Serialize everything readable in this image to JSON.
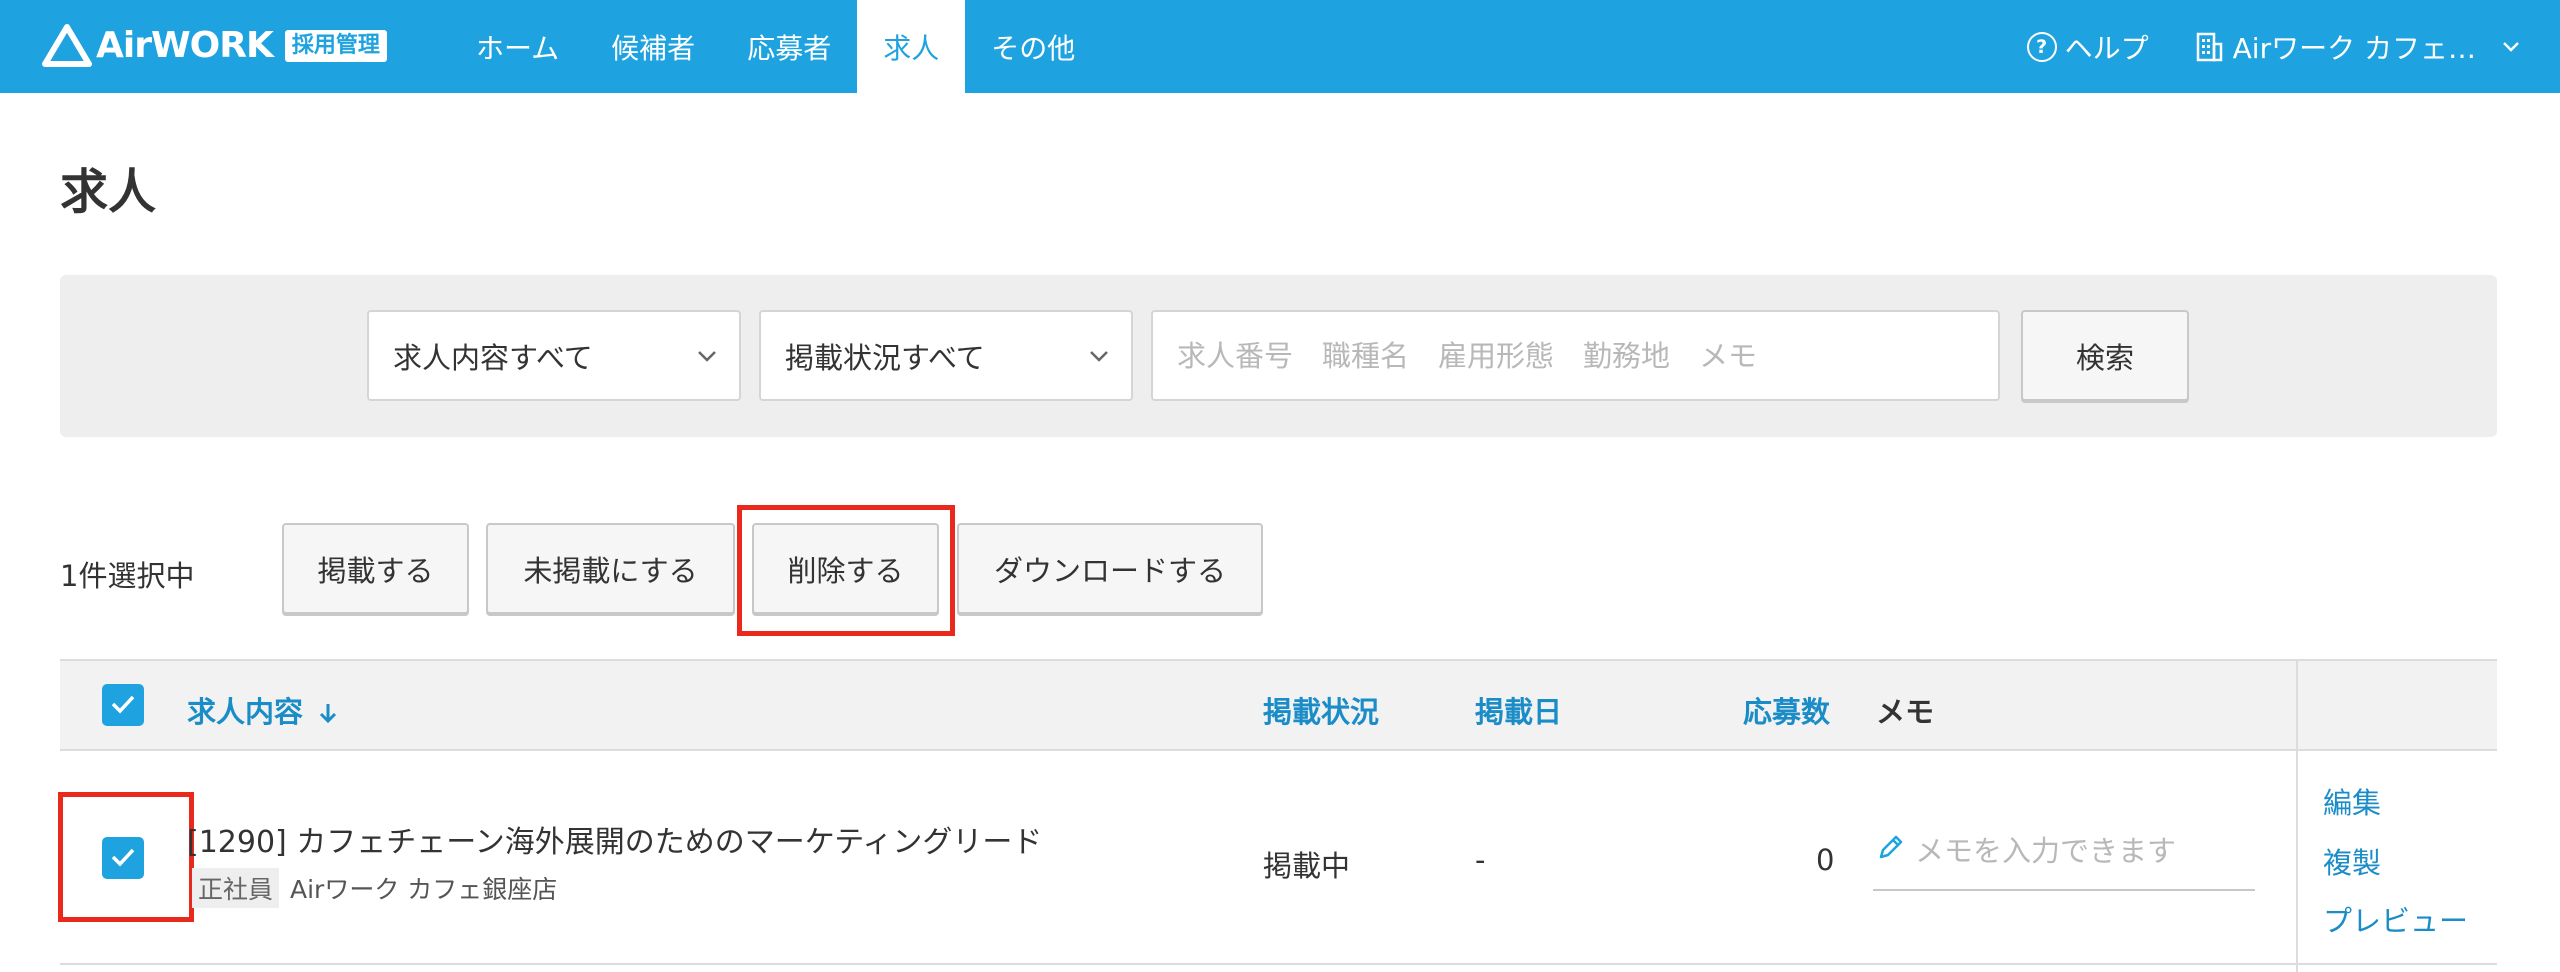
{
  "header": {
    "logo_text": "AirWORK",
    "logo_badge": "採用管理",
    "nav": [
      "ホーム",
      "候補者",
      "応募者",
      "求人",
      "その他"
    ],
    "active_nav": "求人",
    "help_label": "ヘルプ",
    "account_label": "Airワーク カフェ…",
    "brand_color": "#1ea3e0"
  },
  "page": {
    "title": "求人"
  },
  "search": {
    "content_select": "求人内容すべて",
    "status_select": "掲載状況すべて",
    "placeholder": "求人番号　職種名　雇用形態　勤務地　メモ",
    "button": "検索"
  },
  "actions": {
    "selected_count": "1件選択中",
    "publish": "掲載する",
    "unpublish": "未掲載にする",
    "delete": "削除する",
    "download": "ダウンロードする"
  },
  "table": {
    "headers": {
      "content": "求人内容",
      "status": "掲載状況",
      "date": "掲載日",
      "applicants": "応募数",
      "memo": "メモ"
    },
    "rows": [
      {
        "checked": true,
        "title": "[1290] カフェチェーン海外展開のためのマーケティングリード",
        "employment_type": "正社員",
        "store": "Airワーク カフェ銀座店",
        "status": "掲載中",
        "date": "-",
        "applicants": "0",
        "memo_placeholder": "メモを入力できます",
        "links": [
          "編集",
          "複製",
          "プレビュー"
        ]
      }
    ]
  },
  "highlight_color": "#e8291c"
}
